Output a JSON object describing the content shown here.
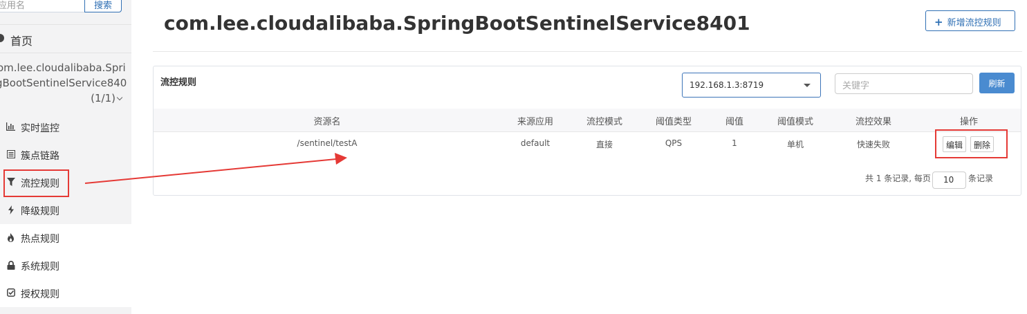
{
  "sidebar": {
    "search_placeholder": "应用名",
    "search_button": "搜索",
    "home_label": "首页",
    "app_line1": "om.lee.cloudalibaba.Spri",
    "app_line2": "gBootSentinelService840",
    "app_count": "(1/1)",
    "items": [
      {
        "label": "实时监控",
        "icon": "bar-chart-icon"
      },
      {
        "label": "簇点链路",
        "icon": "list-icon"
      },
      {
        "label": "流控规则",
        "icon": "filter-icon"
      },
      {
        "label": "降级规则",
        "icon": "flash-icon"
      },
      {
        "label": "热点规则",
        "icon": "fire-icon"
      },
      {
        "label": "系统规则",
        "icon": "lock-icon"
      },
      {
        "label": "授权规则",
        "icon": "check-square-icon"
      }
    ]
  },
  "header": {
    "title": "com.lee.cloudalibaba.SpringBootSentinelService8401",
    "add_button": "新增流控规则"
  },
  "panel": {
    "title": "流控规则",
    "machine": "192.168.1.3:8719",
    "keyword_placeholder": "关键字",
    "refresh_button": "刷新",
    "columns": [
      "资源名",
      "来源应用",
      "流控模式",
      "阈值类型",
      "阈值",
      "阈值模式",
      "流控效果",
      "操作"
    ],
    "row": {
      "resource": "/sentinel/testA",
      "origin": "default",
      "mode": "直接",
      "grade": "QPS",
      "count": "1",
      "cluster": "单机",
      "effect": "快速失败",
      "edit": "编辑",
      "delete": "删除"
    },
    "pager": {
      "prefix": "共 1 条记录, 每页",
      "page_size": "10",
      "suffix": "条记录"
    }
  },
  "colors": {
    "accent": "#2f6fb4",
    "refresh": "#4a8bd0",
    "annotation": "#e53935"
  }
}
